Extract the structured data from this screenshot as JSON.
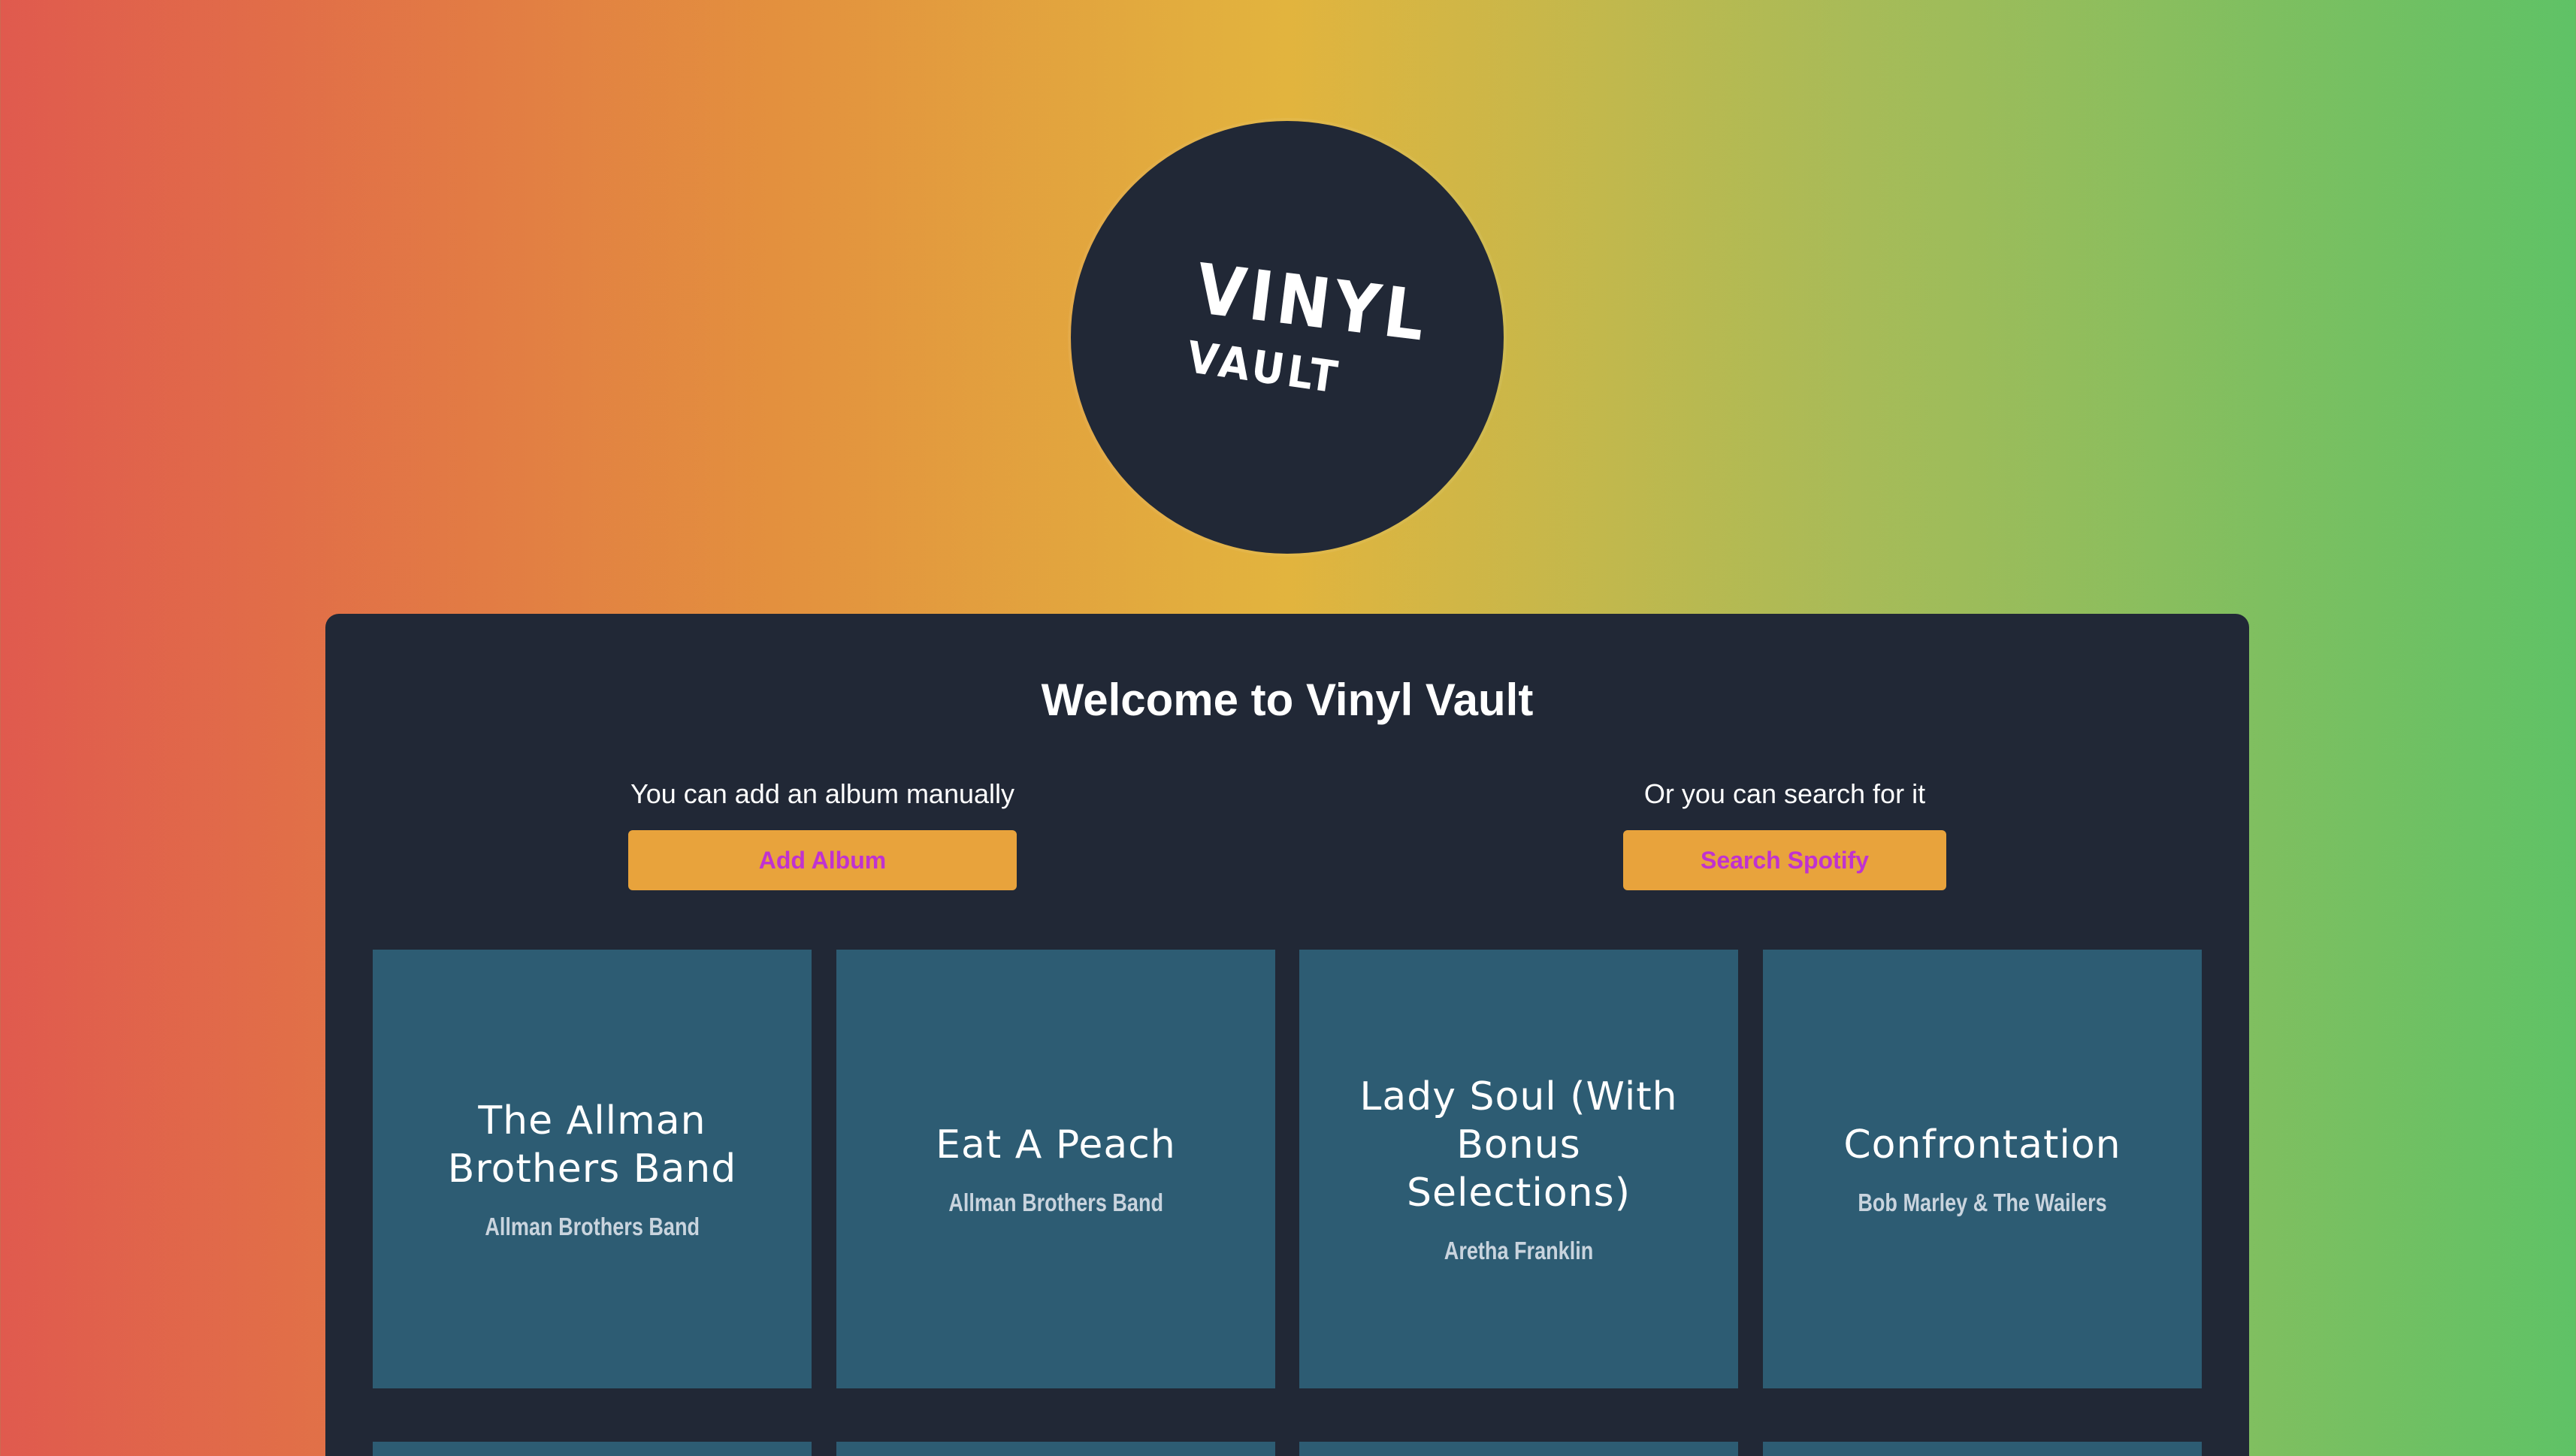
{
  "logo": {
    "line1": "VINYL",
    "line2": "VAULT"
  },
  "colors": {
    "panel": "#212836",
    "card": "#2d5c73",
    "button": "#e8a33c",
    "button_text": "#c032d0"
  },
  "welcome": {
    "title": "Welcome to Vinyl Vault"
  },
  "actions": {
    "manual_text": "You can add an album manually",
    "manual_button": "Add Album",
    "search_text": "Or you can search for it",
    "search_button": "Search Spotify"
  },
  "albums": [
    {
      "title": "The Allman Brothers Band",
      "artist": "Allman Brothers Band"
    },
    {
      "title": "Eat A Peach",
      "artist": "Allman Brothers Band"
    },
    {
      "title": "Lady Soul (With Bonus Selections)",
      "artist": "Aretha Franklin"
    },
    {
      "title": "Confrontation",
      "artist": "Bob Marley & The Wailers"
    }
  ]
}
